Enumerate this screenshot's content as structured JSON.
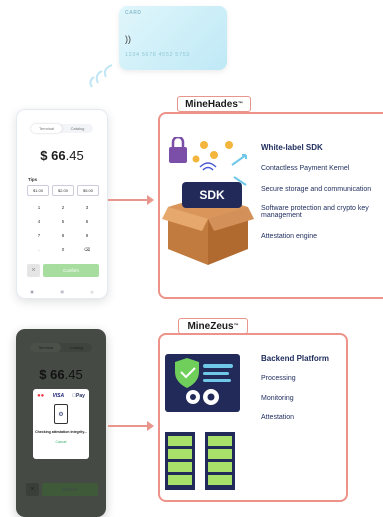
{
  "card": {
    "label": "CARD",
    "number": "1234 5678 4552 5753"
  },
  "pos": {
    "tabs": [
      "Terminal",
      "Catalog"
    ],
    "currency": "$",
    "amount_int": "66",
    "amount_dec": ".45",
    "tips_label": "Tips",
    "tips": [
      "$1.00",
      "$2.00",
      "$5.00"
    ],
    "keys": [
      "1",
      "2",
      "3",
      "4",
      "5",
      "6",
      "7",
      "8",
      "9",
      ".",
      "0",
      "⌫"
    ],
    "clear_label": "×",
    "confirm_label": "Confirm"
  },
  "modal": {
    "brands": [
      "VISA",
      "Pay"
    ],
    "status": "Checking attestation integrity...",
    "cancel": "Cancel"
  },
  "minehades": {
    "tag": "MineHades",
    "tm": "™",
    "sdk_label": "SDK",
    "title": "White-label SDK",
    "items": [
      "Contactless Payment Kernel",
      "Secure storage and communication",
      "Software protection and crypto key management",
      "Attestation engine"
    ]
  },
  "minezeus": {
    "tag": "MineZeus",
    "tm": "™",
    "title": "Backend Platform",
    "items": [
      "Processing",
      "Monitoring",
      "Attestation"
    ]
  },
  "colors": {
    "accent": "#ed9389",
    "navy": "#1d2b5c",
    "green": "#a8dda0"
  }
}
